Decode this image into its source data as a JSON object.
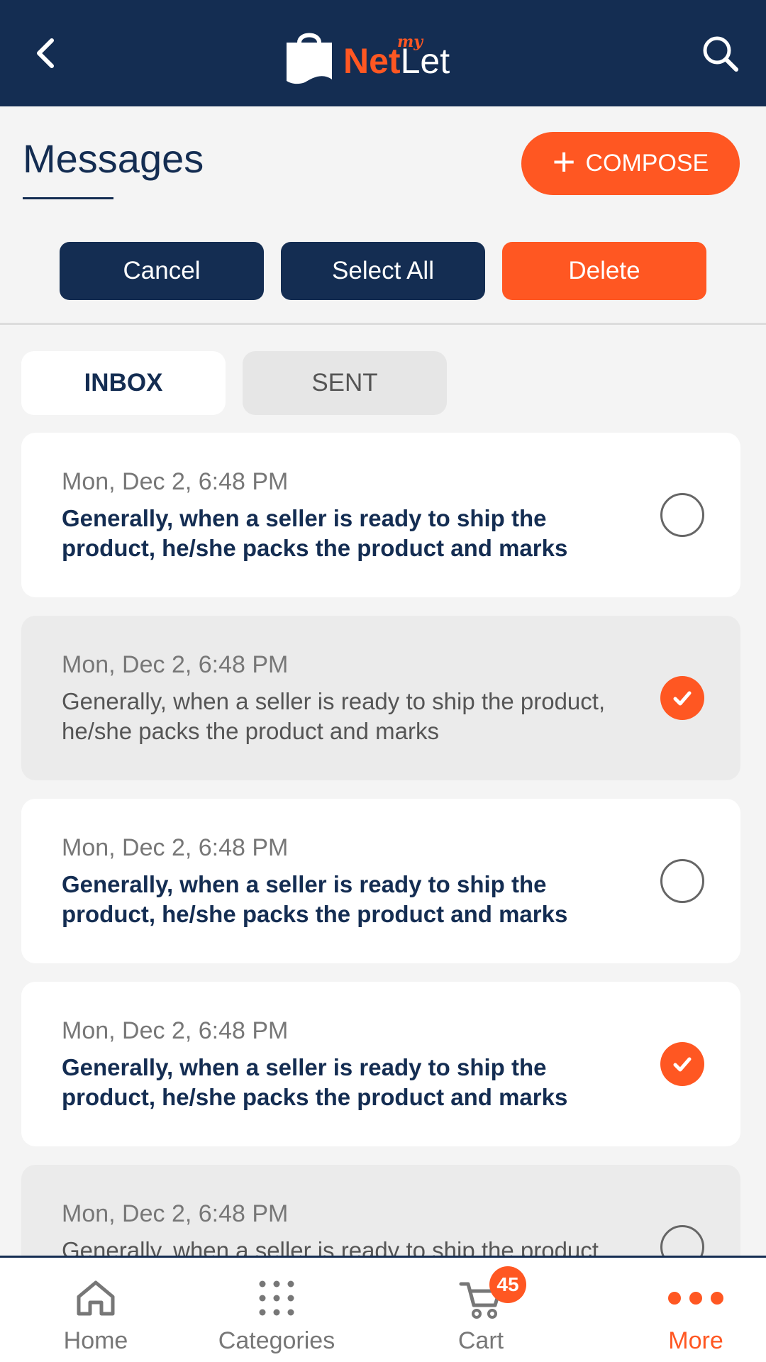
{
  "header": {
    "logo_prefix": "my",
    "logo_net": "Net",
    "logo_let": "Let"
  },
  "page": {
    "title": "Messages",
    "compose_label": "COMPOSE"
  },
  "actions": {
    "cancel_label": "Cancel",
    "select_all_label": "Select All",
    "delete_label": "Delete"
  },
  "tabs": [
    {
      "label": "INBOX",
      "active": true
    },
    {
      "label": "SENT",
      "active": false
    }
  ],
  "messages": [
    {
      "date": "Mon, Dec 2, 6:48 PM",
      "text": "Generally, when a seller is ready to ship the product, he/she packs the product and marks",
      "unread": true,
      "selected": false
    },
    {
      "date": "Mon, Dec 2, 6:48 PM",
      "text": "Generally, when a seller is ready to ship the product, he/she packs the product and marks",
      "unread": false,
      "selected": true
    },
    {
      "date": "Mon, Dec 2, 6:48 PM",
      "text": "Generally, when a seller is ready to ship the product, he/she packs the product and marks",
      "unread": true,
      "selected": false
    },
    {
      "date": "Mon, Dec 2, 6:48 PM",
      "text": "Generally, when a seller is ready to ship the product, he/she packs the product and marks",
      "unread": true,
      "selected": true
    },
    {
      "date": "Mon, Dec 2, 6:48 PM",
      "text": "Generally, when a seller is ready to ship the product, he/she packs the product and marks",
      "unread": false,
      "selected": false
    }
  ],
  "bottom_nav": {
    "items": [
      {
        "label": "Home",
        "icon": "home-icon",
        "active": false
      },
      {
        "label": "Categories",
        "icon": "grid-icon",
        "active": false
      },
      {
        "label": "Cart",
        "icon": "cart-icon",
        "active": false,
        "badge": "45"
      },
      {
        "label": "More",
        "icon": "more-dots-icon",
        "active": true
      }
    ]
  },
  "colors": {
    "navy": "#142d52",
    "accent": "#ff5722",
    "background": "#f4f4f4"
  }
}
